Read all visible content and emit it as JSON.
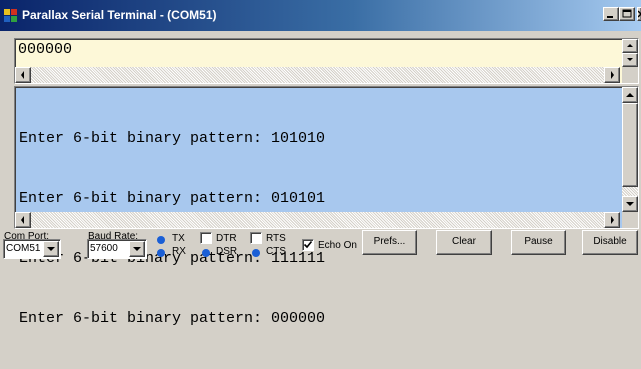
{
  "window": {
    "title": "Parallax Serial Terminal - (COM51)",
    "icon": "parallax-app-icon",
    "controls": {
      "minimize_icon": "minimize-icon",
      "maximize_icon": "maximize-icon",
      "close_icon": "close-icon"
    }
  },
  "transmit_pane": {
    "text": "000000",
    "background": "#fdf8d8"
  },
  "receive_pane": {
    "background": "#a8c8ee",
    "lines": [
      "Enter 6-bit binary pattern: 101010",
      "Enter 6-bit binary pattern: 010101",
      "Enter 6-bit binary pattern: 111111",
      "Enter 6-bit binary pattern: 000000"
    ]
  },
  "controls": {
    "com_port": {
      "label": "Com Port:",
      "value": "COM51"
    },
    "baud_rate": {
      "label": "Baud Rate:",
      "value": "57600"
    },
    "indicators": {
      "tx": {
        "label": "TX",
        "type": "led",
        "color": "#1a5fd6"
      },
      "rx": {
        "label": "RX",
        "type": "led",
        "color": "#1a5fd6"
      },
      "dtr": {
        "label": "DTR",
        "type": "checkbox",
        "checked": false
      },
      "dsr": {
        "label": "DSR",
        "type": "led",
        "color": "#1a5fd6"
      },
      "rts": {
        "label": "RTS",
        "type": "checkbox",
        "checked": false
      },
      "cts": {
        "label": "CTS",
        "type": "led",
        "color": "#1a5fd6"
      }
    },
    "echo_on": {
      "label": "Echo On",
      "checked": true
    },
    "buttons": {
      "prefs": "Prefs...",
      "clear": "Clear",
      "pause": "Pause",
      "disable": "Disable"
    }
  }
}
